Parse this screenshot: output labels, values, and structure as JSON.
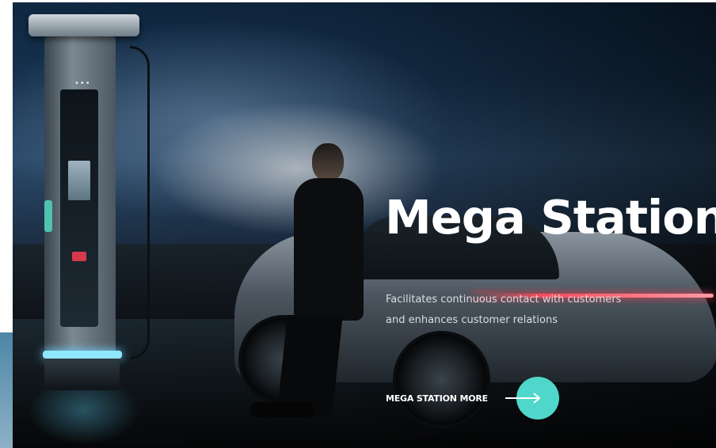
{
  "hero": {
    "title": "Mega Station",
    "subtitle_lines": [
      "Facilitates continuous contact with customers",
      "and enhances customer relations"
    ],
    "cta_label": "MEGA STATION MORE"
  },
  "icons": {
    "cta": "arrow-right-icon"
  },
  "colors": {
    "accent": "#4fd7cb",
    "title_text": "#ffffff",
    "tail_light": "#ff4b5c"
  }
}
